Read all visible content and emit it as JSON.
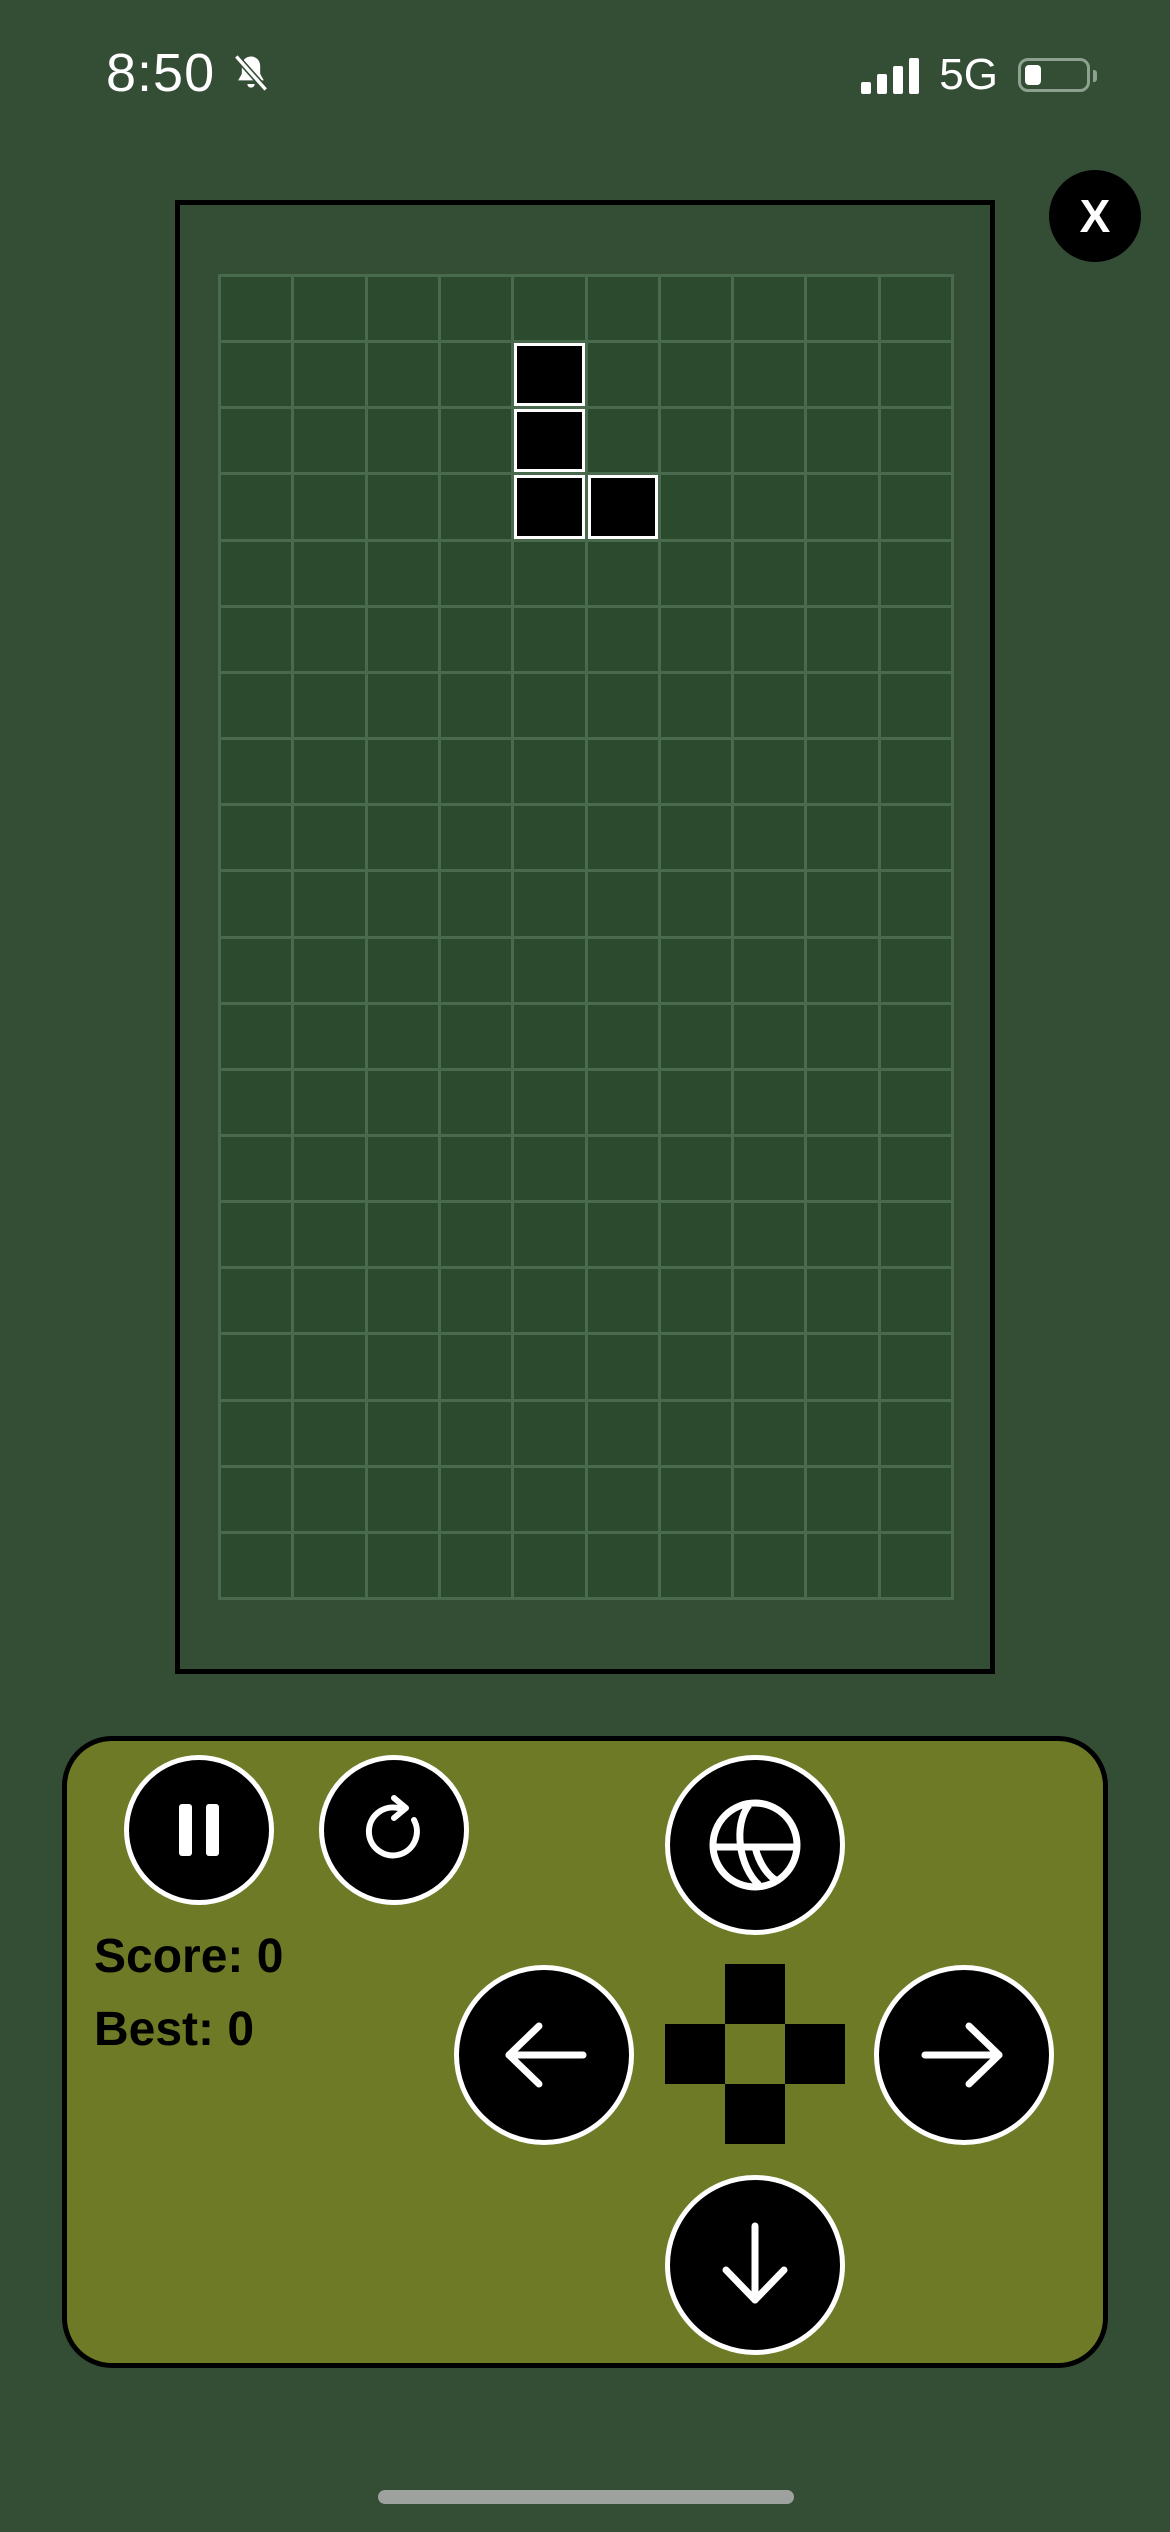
{
  "status_bar": {
    "time": "8:50",
    "network": "5G",
    "icons": [
      "bell-slash-icon",
      "signal-bars-icon",
      "battery-icon"
    ]
  },
  "close_button": {
    "label": "X"
  },
  "board": {
    "columns": 10,
    "rows": 20,
    "active_piece": {
      "shape": "L",
      "cells": [
        [
          1,
          4
        ],
        [
          2,
          4
        ],
        [
          3,
          4
        ],
        [
          3,
          5
        ]
      ]
    },
    "colors": {
      "background": "#344e36",
      "cell": "#2c4a2e",
      "grid_line": "#4a6a4d",
      "piece_fill": "#000000",
      "piece_border": "#ffffff"
    }
  },
  "controls": {
    "pause": {
      "icon": "pause-icon"
    },
    "restart": {
      "icon": "restart-icon"
    },
    "rotate": {
      "icon": "rotate-globe-icon"
    },
    "left": {
      "icon": "arrow-left-icon"
    },
    "right": {
      "icon": "arrow-right-icon"
    },
    "down": {
      "icon": "arrow-down-icon"
    },
    "panel_color": "#6f7a26"
  },
  "score": {
    "score_text": "Score: 0",
    "best_text": "Best: 0"
  }
}
